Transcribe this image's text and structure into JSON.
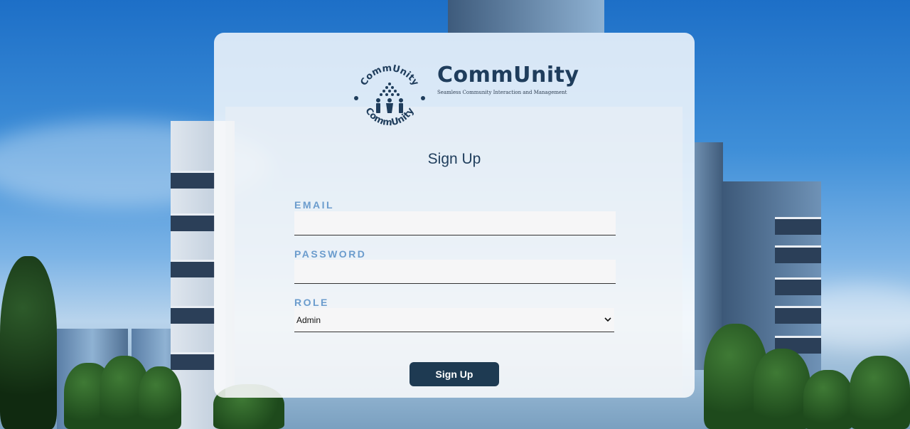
{
  "brand": {
    "name": "CommUnity",
    "tagline": "Seamless Community Interaction and Management",
    "logo_ring_text": "CommUnity CommUnity"
  },
  "form": {
    "title": "Sign Up",
    "email_label": "EMAIL",
    "email_value": "",
    "password_label": "PASSWORD",
    "password_value": "",
    "role_label": "ROLE",
    "role_selected": "Admin",
    "submit_label": "Sign Up"
  },
  "colors": {
    "accent": "#1e3a52",
    "label": "#6b9ccd",
    "brand": "#1f3d5c"
  }
}
